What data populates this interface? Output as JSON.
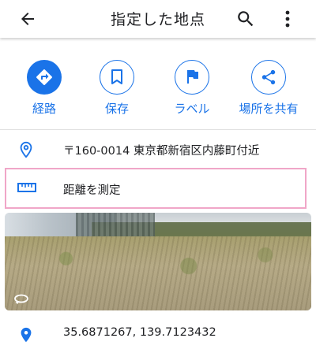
{
  "appbar": {
    "title": "指定した地点",
    "back_icon": "arrow-back-icon",
    "search_icon": "search-icon",
    "more_icon": "more-vert-icon"
  },
  "actions": [
    {
      "label": "経路",
      "icon": "directions-icon",
      "style": "filled"
    },
    {
      "label": "保存",
      "icon": "bookmark-icon",
      "style": "outline"
    },
    {
      "label": "ラベル",
      "icon": "flag-icon",
      "style": "outline"
    },
    {
      "label": "場所を共有",
      "icon": "share-icon",
      "style": "outline"
    }
  ],
  "address": {
    "text": "〒160-0014 東京都新宿区内藤町付近",
    "icon": "location-pin-icon"
  },
  "measure": {
    "text": "距離を測定",
    "icon": "ruler-icon"
  },
  "street_view": {
    "icon": "street-view-360-icon"
  },
  "coordinates": {
    "text": "35.6871267, 139.7123432",
    "icon": "location-pin-filled-icon"
  },
  "colors": {
    "accent": "#1a73e8",
    "highlight": "#f0a6c8"
  }
}
